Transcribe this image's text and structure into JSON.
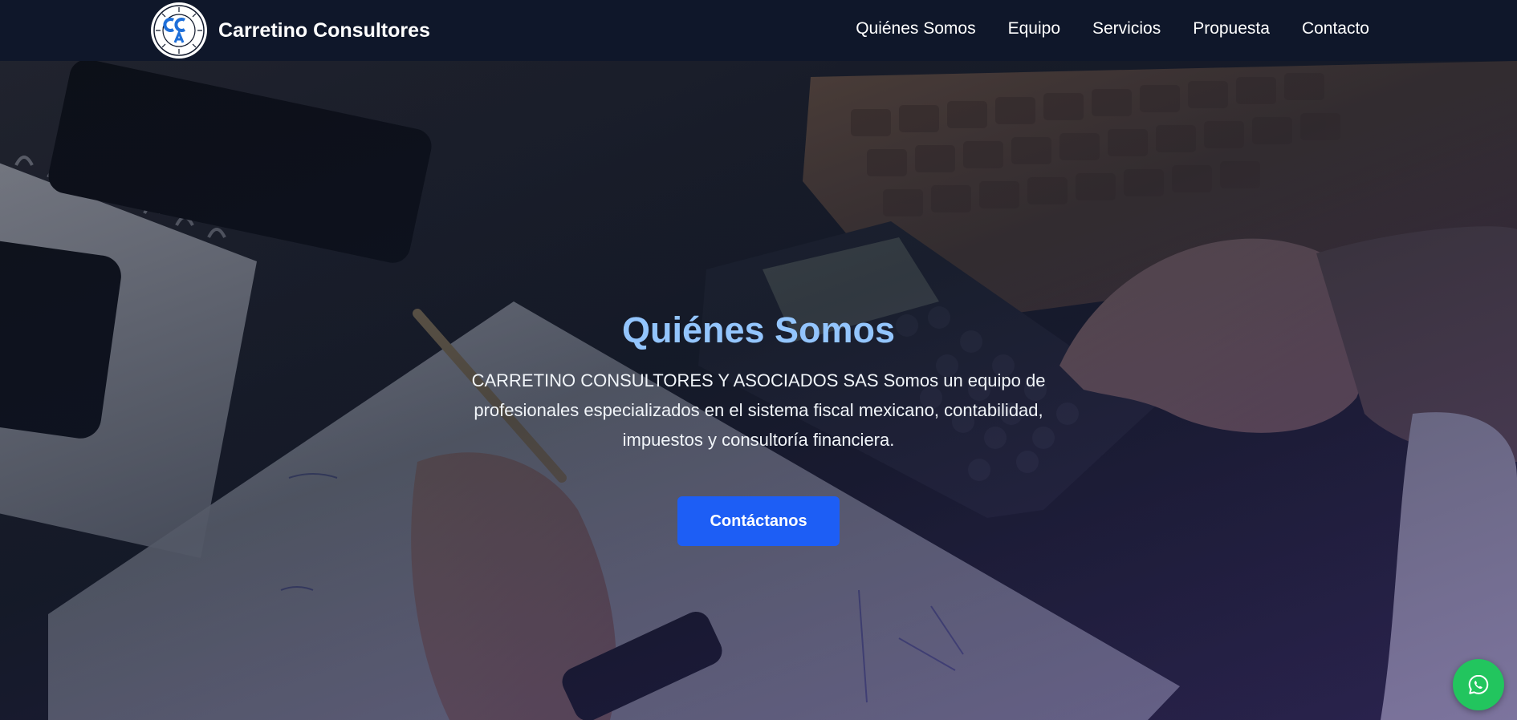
{
  "nav": {
    "brand_name": "Carretino Consultores",
    "logo_alt": "CCA logo",
    "links": [
      "Quiénes Somos",
      "Equipo",
      "Servicios",
      "Propuesta",
      "Contacto"
    ]
  },
  "hero": {
    "title": "Quiénes Somos",
    "text": "CARRETINO CONSULTORES Y ASOCIADOS SAS Somos un equipo de profesionales especializados en el sistema fiscal mexicano, contabilidad, impuestos y consultoría financiera.",
    "cta_label": "Contáctanos"
  },
  "colors": {
    "nav_bg": "#0f172a",
    "title": "#93c5fd",
    "cta_bg": "#1d5ef5",
    "whatsapp_bg": "#22c55e"
  },
  "icons": {
    "logo": "cca-seal-logo",
    "whatsapp": "whatsapp-icon"
  }
}
